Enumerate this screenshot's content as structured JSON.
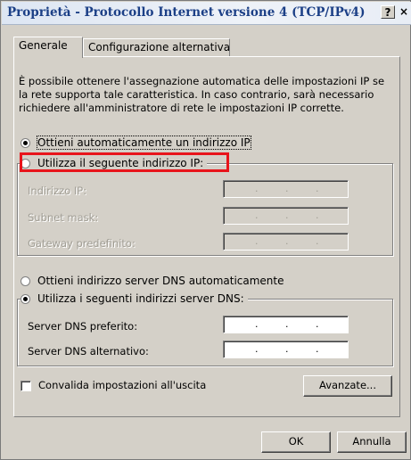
{
  "window": {
    "title": "Proprietà - Protocollo Internet versione 4 (TCP/IPv4)"
  },
  "titlebar": {
    "help_label": "?",
    "close_label": "×"
  },
  "tabs": [
    {
      "label": "Generale"
    },
    {
      "label": "Configurazione alternativa"
    }
  ],
  "description": "È possibile ottenere l'assegnazione automatica delle impostazioni IP se la rete supporta tale caratteristica. In caso contrario, sarà necessario richiedere all'amministratore di rete le impostazioni IP corrette.",
  "ip_section": {
    "auto_option": "Ottieni automaticamente un indirizzo IP",
    "manual_option": "Utilizza il seguente indirizzo IP:",
    "selected": "auto",
    "fields": [
      {
        "label": "Indirizzo IP:",
        "value": ". . ."
      },
      {
        "label": "Subnet mask:",
        "value": ". . ."
      },
      {
        "label": "Gateway predefinito:",
        "value": ". . ."
      }
    ]
  },
  "dns_section": {
    "auto_option": "Ottieni indirizzo server DNS automaticamente",
    "manual_option": "Utilizza i seguenti indirizzi server DNS:",
    "selected": "manual",
    "fields": [
      {
        "label": "Server DNS preferito:",
        "value": ". . ."
      },
      {
        "label": "Server DNS alternativo:",
        "value": ". . ."
      }
    ]
  },
  "validate_checkbox": {
    "label": "Convalida impostazioni all'uscita",
    "checked": false
  },
  "buttons": {
    "advanced": "Avanzate...",
    "ok": "OK",
    "cancel": "Annulla"
  },
  "colors": {
    "highlight": "#e8141b",
    "title_text": "#1b3f86",
    "dialog_bg": "#d4d0c8"
  }
}
